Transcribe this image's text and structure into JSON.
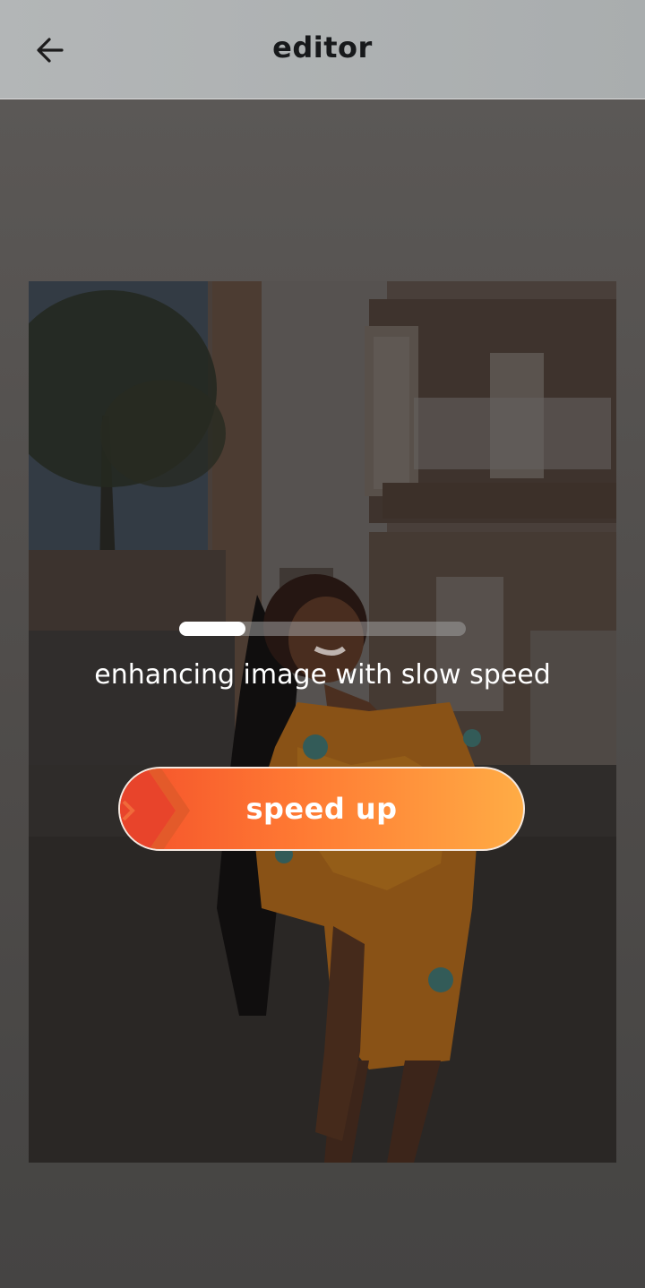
{
  "header": {
    "title": "editor",
    "back_icon": "arrow-left-icon"
  },
  "editor": {
    "progress": 0.23,
    "status_text": "enhancing image with slow speed",
    "speed_up_label": "speed up",
    "speed_icon": "double-chevron-right-icon"
  },
  "colors": {
    "button_gradient_start": "#f4512b",
    "button_gradient_end": "#ffac45",
    "header_bg": "#b3b6b7"
  }
}
